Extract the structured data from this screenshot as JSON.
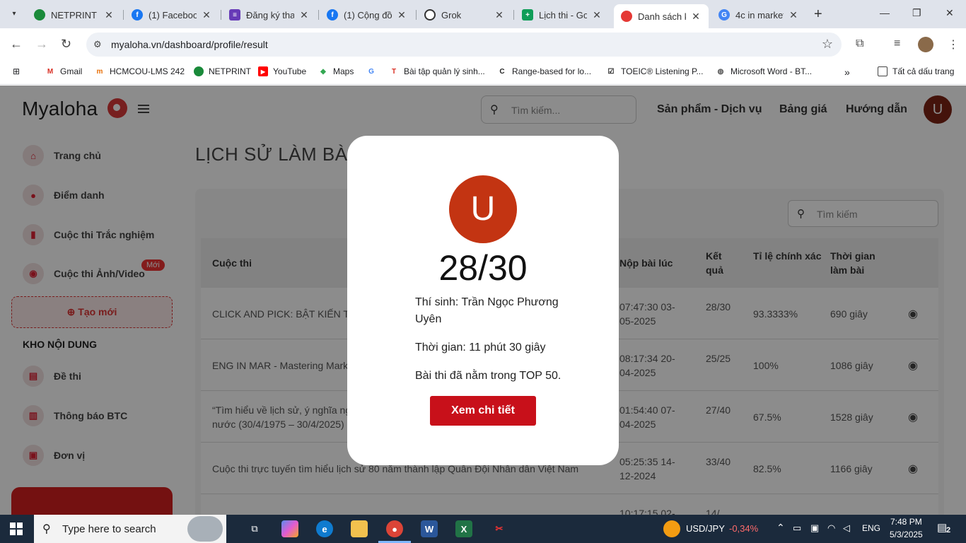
{
  "browser": {
    "tabs": [
      {
        "title": "NETPRINT",
        "favicon_color": "#1a8a3a"
      },
      {
        "title": "(1) Facebook",
        "favicon_color": "#1877f2"
      },
      {
        "title": "Đăng ký tha",
        "favicon_color": "#673ab7"
      },
      {
        "title": "(1) Cộng đồ",
        "favicon_color": "#1877f2"
      },
      {
        "title": "Grok",
        "favicon_color": "#333333"
      },
      {
        "title": "Lịch thi - Go",
        "favicon_color": "#0f9d58"
      },
      {
        "title": "Danh sách k",
        "favicon_color": "#e53935",
        "active": true
      },
      {
        "title": "4c in market",
        "favicon_color": "#4285f4"
      }
    ],
    "url": "myaloha.vn/dashboard/profile/result",
    "bookmarks": [
      "Gmail",
      "HCMCOU-LMS 242",
      "NETPRINT",
      "YouTube",
      "Maps",
      "",
      "Bài tập quản lý sinh...",
      "Range-based for lo...",
      "TOEIC® Listening P...",
      "Microsoft Word - BT..."
    ],
    "all_bookmarks": "Tất cả dấu trang",
    "close_glyph": "✕",
    "more_glyph": "»"
  },
  "site": {
    "logo": "Myaloha",
    "search_placeholder": "Tìm kiếm...",
    "nav": [
      "Sản phẩm - Dịch vụ",
      "Bảng giá",
      "Hướng dẫn"
    ],
    "avatar_letter": "U"
  },
  "sidebar": {
    "items": [
      {
        "label": "Trang chủ",
        "icon": "home-icon",
        "glyph": "⌂"
      },
      {
        "label": "Điểm danh",
        "icon": "person-icon",
        "glyph": "●"
      },
      {
        "label": "Cuộc thi Trắc nghiệm",
        "icon": "chart-icon",
        "glyph": "▮"
      },
      {
        "label": "Cuộc thi Ảnh/Video",
        "icon": "camera-icon",
        "glyph": "◉"
      }
    ],
    "badge_new": "Mới",
    "create_label": "Tạo mới",
    "create_glyph": "⊕",
    "section_title": "KHO NỘI DUNG",
    "content_items": [
      {
        "label": "Đề thi",
        "icon": "document-icon",
        "glyph": "▤"
      },
      {
        "label": "Thông báo BTC",
        "icon": "book-icon",
        "glyph": "▥"
      },
      {
        "label": "Đơn vị",
        "icon": "briefcase-icon",
        "glyph": "▣"
      }
    ]
  },
  "main": {
    "heading": "LỊCH SỬ LÀM BÀI",
    "table_search_placeholder": "Tìm kiếm",
    "headers": {
      "contest": "Cuộc thi",
      "submitted": "Nộp bài lúc",
      "result": "Kết quả",
      "accuracy": "Tỉ lệ chính xác",
      "duration": "Thời gian làm bài"
    },
    "rows": [
      {
        "contest": "CLICK AND PICK: BẬT KIẾN TH",
        "submitted": "07:47:30 03-05-2025",
        "result": "28/30",
        "accuracy": "93.3333%",
        "duration": "690 giây"
      },
      {
        "contest": "ENG IN MAR - Mastering Mark",
        "submitted": "08:17:34 20-04-2025",
        "result": "25/25",
        "accuracy": "100%",
        "duration": "1086 giây"
      },
      {
        "contest": "“Tìm hiểu về lịch sử, ý nghĩa ng nước (30/4/1975 – 30/4/2025)",
        "submitted": "01:54:40 07-04-2025",
        "result": "27/40",
        "accuracy": "67.5%",
        "duration": "1528 giây"
      },
      {
        "contest": "Cuộc thi trực tuyến tìm hiểu lịch sử 80 năm thành lập Quân Đội Nhân dân Việt Nam",
        "submitted": "05:25:35 14-12-2024",
        "result": "33/40",
        "accuracy": "82.5%",
        "duration": "1166 giây"
      },
      {
        "contest": "",
        "submitted": "10:17:15 02-",
        "result": "14/",
        "accuracy": "",
        "duration": ""
      }
    ]
  },
  "modal": {
    "avatar_letter": "U",
    "score": "28/30",
    "candidate": "Thí sinh: Trần Ngọc Phương Uyên",
    "time": "Thời gian: 11 phút 30 giây",
    "rank": "Bài thi đã nằm trong TOP 50.",
    "button": "Xem chi tiết"
  },
  "taskbar": {
    "search_placeholder": "Type here to search",
    "currency": "USD/JPY",
    "currency_change": "-0,34%",
    "language": "ENG",
    "time": "7:48 PM",
    "date": "5/3/2025",
    "notifications": "2"
  }
}
